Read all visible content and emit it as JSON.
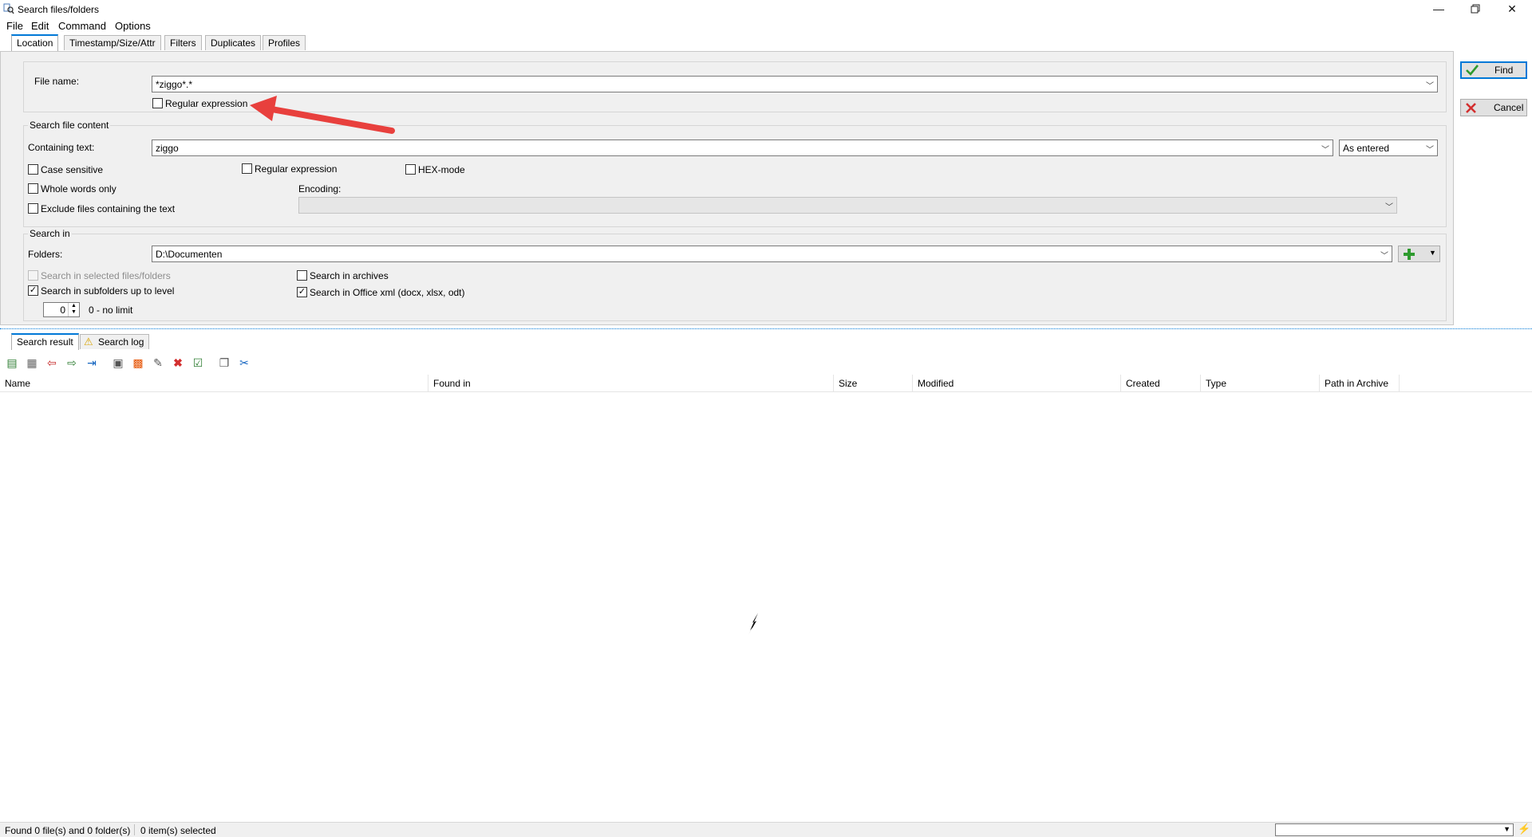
{
  "window": {
    "title": "Search files/folders",
    "controls": [
      "minimize-icon",
      "restore-icon",
      "close-icon"
    ]
  },
  "menu": [
    "File",
    "Edit",
    "Command",
    "Options"
  ],
  "tabs": [
    "Location",
    "Timestamp/Size/Attr",
    "Filters",
    "Duplicates",
    "Profiles"
  ],
  "location": {
    "file_name_label": "File name:",
    "file_name_value": "*ziggo*.*",
    "regex_label": "Regular expression"
  },
  "content": {
    "group_title": "Search file content",
    "containing_label": "Containing text:",
    "containing_value": "ziggo",
    "mode_value": "As entered",
    "case_sensitive": "Case sensitive",
    "regex": "Regular expression",
    "hex_mode": "HEX-mode",
    "whole_words": "Whole words only",
    "encoding_label": "Encoding:",
    "exclude": "Exclude files containing the text"
  },
  "searchin": {
    "group_title": "Search in",
    "folders_label": "Folders:",
    "folders_value": "D:\\Documenten",
    "selected_files": "Search in selected files/folders",
    "archives": "Search in archives",
    "subfolders": "Search in subfolders up to level",
    "office_xml": "Search in Office xml (docx, xlsx, odt)",
    "level_value": "0",
    "level_hint": "0 - no limit"
  },
  "buttons": {
    "find": "Find",
    "cancel": "Cancel"
  },
  "result_tabs": [
    "Search result",
    "Search log"
  ],
  "columns": [
    "Name",
    "Found in",
    "Size",
    "Modified",
    "Created",
    "Type",
    "Path in Archive"
  ],
  "status": {
    "found": "Found 0 file(s) and 0 folder(s)",
    "selected": "0 item(s) selected"
  },
  "colors": {
    "accent": "#0078d7",
    "arrow": "#e8403d",
    "find_check": "#2e9a2e",
    "cancel_x": "#d32f2f"
  }
}
